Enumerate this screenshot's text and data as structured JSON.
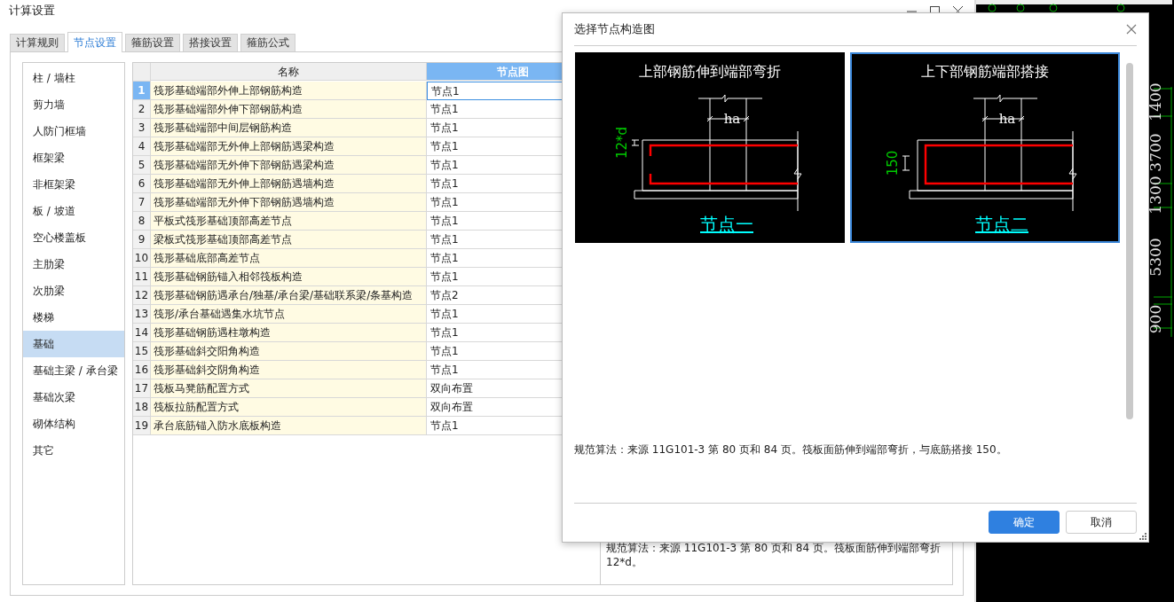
{
  "window": {
    "title": "计算设置"
  },
  "tabs": [
    {
      "label": "计算规则",
      "selected": false
    },
    {
      "label": "节点设置",
      "selected": true
    },
    {
      "label": "箍筋设置",
      "selected": false
    },
    {
      "label": "搭接设置",
      "selected": false
    },
    {
      "label": "箍筋公式",
      "selected": false
    }
  ],
  "sidebar": {
    "items": [
      {
        "label": "柱 / 墙柱",
        "selected": false
      },
      {
        "label": "剪力墙",
        "selected": false
      },
      {
        "label": "人防门框墙",
        "selected": false
      },
      {
        "label": "框架梁",
        "selected": false
      },
      {
        "label": "非框架梁",
        "selected": false
      },
      {
        "label": "板 / 坡道",
        "selected": false
      },
      {
        "label": "空心楼盖板",
        "selected": false
      },
      {
        "label": "主肋梁",
        "selected": false
      },
      {
        "label": "次肋梁",
        "selected": false
      },
      {
        "label": "楼梯",
        "selected": false
      },
      {
        "label": "基础",
        "selected": true
      },
      {
        "label": "基础主梁 / 承台梁",
        "selected": false
      },
      {
        "label": "基础次梁",
        "selected": false
      },
      {
        "label": "砌体结构",
        "selected": false
      },
      {
        "label": "其它",
        "selected": false
      }
    ]
  },
  "table": {
    "columns": [
      {
        "label": "名称",
        "selected": false
      },
      {
        "label": "节点图",
        "selected": true
      }
    ],
    "rows": [
      {
        "index": "1",
        "name": "筏形基础端部外伸上部钢筋构造",
        "node": "节点1",
        "selected": true
      },
      {
        "index": "2",
        "name": "筏形基础端部外伸下部钢筋构造",
        "node": "节点1",
        "selected": false
      },
      {
        "index": "3",
        "name": "筏形基础端部中间层钢筋构造",
        "node": "节点1",
        "selected": false
      },
      {
        "index": "4",
        "name": "筏形基础端部无外伸上部钢筋遇梁构造",
        "node": "节点1",
        "selected": false
      },
      {
        "index": "5",
        "name": "筏形基础端部无外伸下部钢筋遇梁构造",
        "node": "节点1",
        "selected": false
      },
      {
        "index": "6",
        "name": "筏形基础端部无外伸上部钢筋遇墙构造",
        "node": "节点1",
        "selected": false
      },
      {
        "index": "7",
        "name": "筏形基础端部无外伸下部钢筋遇墙构造",
        "node": "节点1",
        "selected": false
      },
      {
        "index": "8",
        "name": "平板式筏形基础顶部高差节点",
        "node": "节点1",
        "selected": false
      },
      {
        "index": "9",
        "name": "梁板式筏形基础顶部高差节点",
        "node": "节点1",
        "selected": false
      },
      {
        "index": "10",
        "name": "筏形基础底部高差节点",
        "node": "节点1",
        "selected": false
      },
      {
        "index": "11",
        "name": "筏形基础钢筋锚入相邻筏板构造",
        "node": "节点1",
        "selected": false
      },
      {
        "index": "12",
        "name": "筏形基础钢筋遇承台/独基/承台梁/基础联系梁/条基构造",
        "node": "节点2",
        "selected": false
      },
      {
        "index": "13",
        "name": "筏形/承台基础遇集水坑节点",
        "node": "节点1",
        "selected": false
      },
      {
        "index": "14",
        "name": "筏形基础钢筋遇柱墩构造",
        "node": "节点1",
        "selected": false
      },
      {
        "index": "15",
        "name": "筏形基础斜交阳角构造",
        "node": "节点1",
        "selected": false
      },
      {
        "index": "16",
        "name": "筏形基础斜交阴角构造",
        "node": "节点1",
        "selected": false
      },
      {
        "index": "17",
        "name": "筏板马凳筋配置方式",
        "node": "双向布置",
        "selected": false
      },
      {
        "index": "18",
        "name": "筏板拉筋配置方式",
        "node": "双向布置",
        "selected": false
      },
      {
        "index": "19",
        "name": "承台底筋锚入防水底板构造",
        "node": "节点1",
        "selected": false
      }
    ]
  },
  "description": "规范算法：来源 11G101-3 第 80 页和 84 页。筏板面筋伸到端部弯折 12*d。",
  "cad_ruler": {
    "labels": [
      "1400",
      "3700",
      "1300",
      "5300",
      "900"
    ]
  },
  "dialog": {
    "title": "选择节点构造图",
    "nodes": [
      {
        "kind": "bend",
        "title": "上部钢筋伸到端部弯折",
        "width_label": "ha",
        "dimension": "12*d",
        "caption": "节点一",
        "selected": false
      },
      {
        "kind": "lap",
        "title": "上下部钢筋端部搭接",
        "width_label": "ha",
        "dimension": "150",
        "caption": "节点二",
        "selected": true
      }
    ],
    "description": "规范算法：来源 11G101-3 第 80 页和 84 页。筏板面筋伸到端部弯折，与底筋搭接 150。",
    "buttons": [
      {
        "label": "确定",
        "kind": "primary"
      },
      {
        "label": "取消",
        "kind": "secondary"
      }
    ]
  }
}
